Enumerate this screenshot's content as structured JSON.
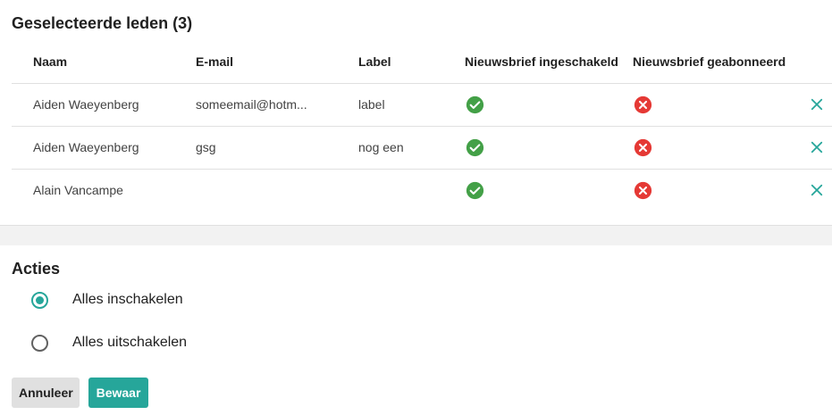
{
  "selected_members": {
    "title": "Geselecteerde leden (3)",
    "columns": [
      "Naam",
      "E-mail",
      "Label",
      "Nieuwsbrief ingeschakeld",
      "Nieuwsbrief geabonneerd"
    ],
    "rows": [
      {
        "name": "Aiden Waeyenberg",
        "email": "someemail@hotm...",
        "label": "label",
        "newsletter_enabled": "check-circle-icon",
        "newsletter_subscribed": "x-circle-icon"
      },
      {
        "name": "Aiden Waeyenberg",
        "email": "gsg",
        "label": "nog een",
        "newsletter_enabled": "check-circle-icon",
        "newsletter_subscribed": "x-circle-icon"
      },
      {
        "name": "Alain Vancampe",
        "email": "",
        "label": "",
        "newsletter_enabled": "check-circle-icon",
        "newsletter_subscribed": "x-circle-icon"
      }
    ]
  },
  "actions": {
    "title": "Acties",
    "options": [
      {
        "label": "Alles inschakelen",
        "selected": true
      },
      {
        "label": "Alles uitschakelen",
        "selected": false
      }
    ]
  },
  "buttons": {
    "cancel_label": "Annuleer",
    "save_label": "Bewaar"
  },
  "colors": {
    "accent": "#26a69a",
    "success": "#43a047",
    "error": "#e53935"
  }
}
